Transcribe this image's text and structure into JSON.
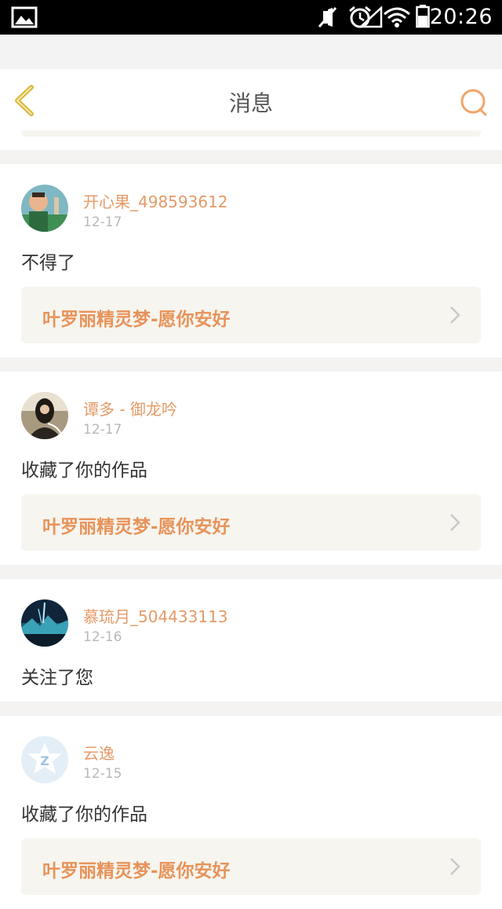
{
  "status_bar": {
    "time": "20:26",
    "icons": [
      "image-icon",
      "mute-icon",
      "alarm-icon",
      "wifi-icon",
      "signal-icon",
      "battery-icon"
    ]
  },
  "header": {
    "title": "消息",
    "back_icon": "back-chevron-icon",
    "search_icon": "search-icon"
  },
  "colors": {
    "accent": "#e8935a",
    "username": "#e59a67",
    "date": "#b8b8b8",
    "card_bg": "#f6f5ef",
    "page_bg": "#f5f3f1"
  },
  "messages": [
    {
      "user": "开心果_498593612",
      "date": "12-17",
      "text": "不得了",
      "work_title": "叶罗丽精灵梦-愿你安好"
    },
    {
      "user": "谭多 - 御龙吟",
      "date": "12-17",
      "text": "收藏了你的作品",
      "work_title": "叶罗丽精灵梦-愿你安好"
    },
    {
      "user": "慕琉月_504433113",
      "date": "12-16",
      "text": "关注了您"
    },
    {
      "user": "云逸",
      "date": "12-15",
      "text": "收藏了你的作品",
      "work_title": "叶罗丽精灵梦-愿你安好"
    }
  ]
}
